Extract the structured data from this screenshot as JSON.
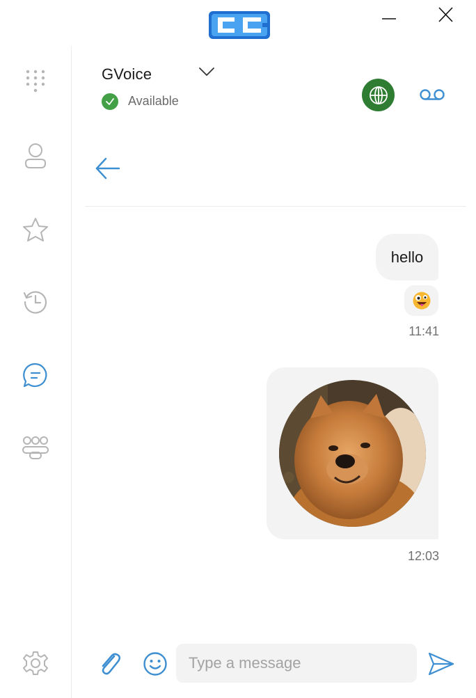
{
  "window": {
    "logo_icon": "app-logo-icon",
    "minimize_icon": "minimize-icon",
    "close_icon": "close-icon"
  },
  "sidebar": {
    "items": [
      {
        "id": "dialpad",
        "icon": "dialpad-icon",
        "active": false
      },
      {
        "id": "contacts",
        "icon": "person-icon",
        "active": false
      },
      {
        "id": "favorites",
        "icon": "star-icon",
        "active": false
      },
      {
        "id": "history",
        "icon": "history-icon",
        "active": false
      },
      {
        "id": "chat",
        "icon": "chat-icon",
        "active": true
      },
      {
        "id": "groups",
        "icon": "group-icon",
        "active": false
      },
      {
        "id": "settings",
        "icon": "gear-icon",
        "active": false
      }
    ]
  },
  "account": {
    "name": "GVoice",
    "status": "Available",
    "status_color": "#43a047"
  },
  "header_actions": {
    "globe_icon": "globe-icon",
    "globe_bg": "#2e7d32",
    "voicemail_icon": "voicemail-icon"
  },
  "conversation": {
    "messages": [
      {
        "type": "text",
        "text": "hello"
      },
      {
        "type": "emoji",
        "icon": "zany-face-emoji-icon"
      },
      {
        "type": "time",
        "text": "11:41"
      },
      {
        "type": "image",
        "alt": "chow chow dog photo"
      },
      {
        "type": "time",
        "text": "12:03"
      }
    ]
  },
  "composer": {
    "placeholder": "Type a message",
    "value": "",
    "attach_icon": "paperclip-icon",
    "emoji_icon": "smiley-icon",
    "send_icon": "send-icon"
  },
  "colors": {
    "accent": "#3d8fd1",
    "bubble_bg": "#f3f3f3",
    "inactive_icon": "#b5b5b5"
  }
}
